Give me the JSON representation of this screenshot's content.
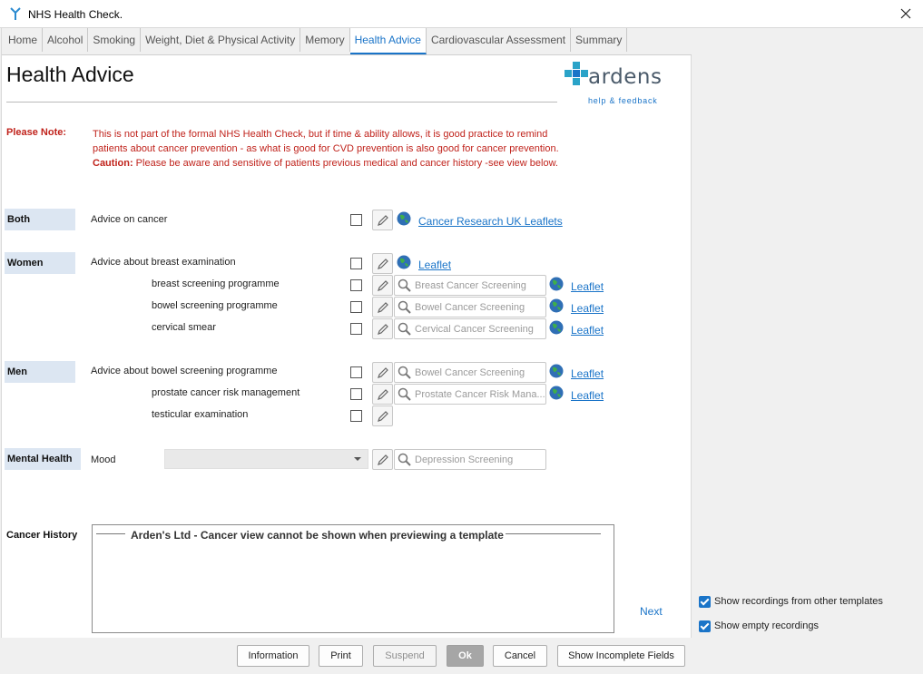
{
  "window": {
    "title": "NHS Health Check."
  },
  "tabs": [
    {
      "label": "Home"
    },
    {
      "label": "Alcohol"
    },
    {
      "label": "Smoking"
    },
    {
      "label": "Weight, Diet & Physical Activity"
    },
    {
      "label": "Memory"
    },
    {
      "label": "Health Advice",
      "active": true
    },
    {
      "label": "Cardiovascular Assessment"
    },
    {
      "label": "Summary"
    }
  ],
  "page": {
    "title": "Health Advice"
  },
  "logo": {
    "word": "ardens",
    "sub": "help & feedback"
  },
  "note": {
    "label": "Please Note:",
    "line1": "This is not part of the formal NHS Health Check, but if time & ability allows, it is good practice to remind",
    "line2": "patients about cancer prevention - as what is good for CVD prevention is also good for cancer prevention.",
    "caution_label": "Caution:",
    "caution_text": "Please be aware and sensitive of patients previous medical and cancer history -see view below."
  },
  "sections": {
    "both": "Both",
    "women": "Women",
    "men": "Men",
    "mental": "Mental Health",
    "cancer_history": "Cancer History"
  },
  "rows": {
    "advice_cancer": {
      "label": "Advice on cancer",
      "link": "Cancer Research UK Leaflets"
    },
    "breast_exam": {
      "label": "Advice about breast examination",
      "link": "Leaflet"
    },
    "breast_screen": {
      "label": "breast screening programme",
      "search": "Breast Cancer Screening",
      "link": "Leaflet"
    },
    "bowel_screen_w": {
      "label": "bowel screening programme",
      "search": "Bowel Cancer Screening",
      "link": "Leaflet"
    },
    "cervical": {
      "label": "cervical smear",
      "search": "Cervical Cancer Screening",
      "link": "Leaflet"
    },
    "bowel_men": {
      "label": "Advice about bowel screening programme",
      "search": "Bowel Cancer Screening",
      "link": "Leaflet"
    },
    "prostate": {
      "label": "prostate cancer risk management",
      "search": "Prostate Cancer Risk Mana...",
      "link": "Leaflet"
    },
    "testicular": {
      "label": "testicular examination"
    },
    "mood": {
      "label": "Mood",
      "search": "Depression Screening"
    }
  },
  "history": {
    "title": "Arden's Ltd - Cancer view cannot be shown when previewing a template"
  },
  "next": "Next",
  "options": {
    "show_other": "Show recordings from other templates",
    "show_empty": "Show empty recordings"
  },
  "footer": {
    "information": "Information",
    "print": "Print",
    "suspend": "Suspend",
    "ok": "Ok",
    "cancel": "Cancel",
    "show_incomplete": "Show Incomplete Fields"
  },
  "colors": {
    "accent": "#1a74c8",
    "note_red": "#c0231c",
    "section_bg": "#dce6f2"
  }
}
